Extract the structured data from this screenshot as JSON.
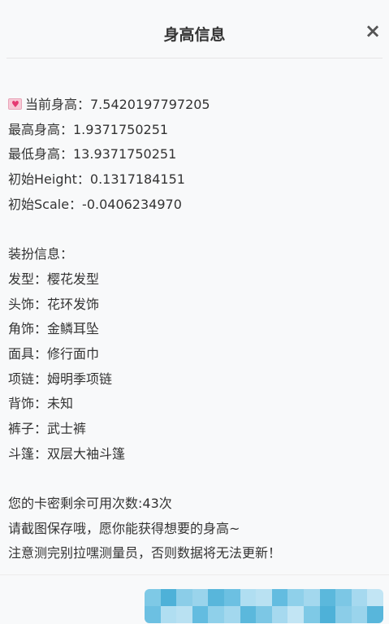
{
  "dialog": {
    "title": "身高信息",
    "close_symbol": "×"
  },
  "height_info": {
    "current": "当前身高：7.5420197797205",
    "max": "最高身高：1.9371750251",
    "min": "最低身高：13.9371750251",
    "initial_height": "初始Height：0.1317184151",
    "initial_scale": "初始Scale：-0.0406234970"
  },
  "outfit": {
    "header": "装扮信息：",
    "items": [
      "发型：樱花发型",
      "头饰：花环发饰",
      "角饰：金鳞耳坠",
      "面具：修行面巾",
      "项链：姆明季项链",
      "背饰：未知",
      "裤子：武士裤",
      "斗篷：双层大袖斗篷"
    ]
  },
  "notes": {
    "remaining": "您的卡密剩余可用次数:43次",
    "screenshot_tip": "请截图保存哦，愿你能获得想要的身高~",
    "warning": "注意测完别拉嘿测量员，否则数据将无法更新！"
  },
  "icons": {
    "heart": "heart-emoji-icon",
    "close": "close-icon"
  },
  "colors": {
    "mosaic": [
      "#7ec9e6",
      "#a6d9ef",
      "#5bb8dc",
      "#8fd0ea",
      "#b9e1f2",
      "#6cc0e2",
      "#9ad4ec",
      "#4eb1d8",
      "#c2e5f4",
      "#7cc7e5",
      "#a3d8ee",
      "#63bce0",
      "#b0def1",
      "#58b6db",
      "#8bcde8"
    ]
  }
}
